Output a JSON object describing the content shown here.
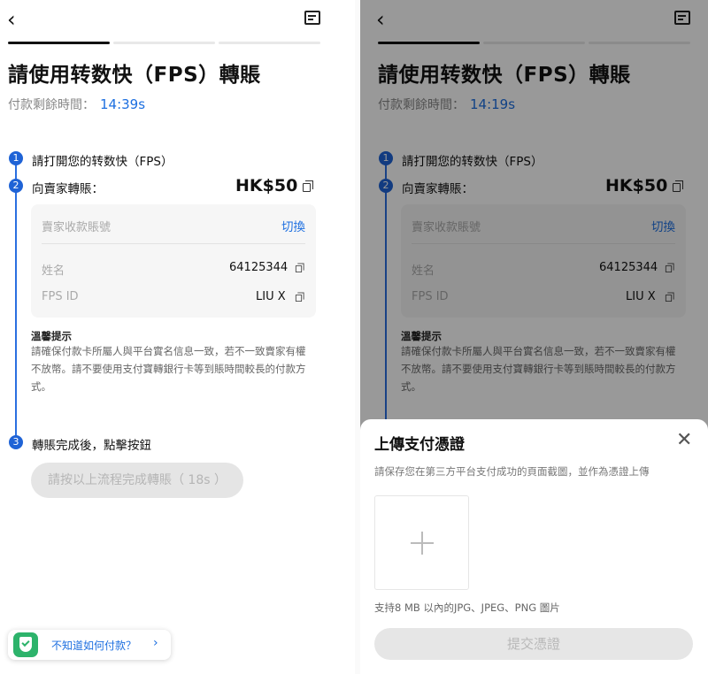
{
  "page": {
    "back_icon": "chevron-left-icon",
    "chat_icon": "message-icon",
    "title": "請使用转数快（FPS）轉賬",
    "timer_label": "付款剩餘時間：",
    "timer_left": "14:39s",
    "timer_right": "14:19s",
    "progress_steps": 3,
    "progress_active": 1
  },
  "steps": {
    "step1_num": "1",
    "step1_text": "請打開您的转数快（FPS）",
    "step2_num": "2",
    "step2_text": "向賣家轉賬：",
    "amount": "HK$50",
    "step3_num": "3",
    "step3_text": "轉賬完成後，點擊按鈕"
  },
  "card": {
    "account_label": "賣家收款賬號",
    "switch_label": "切換",
    "name_label": "姓名",
    "name_value": "64125344",
    "fpsid_label": "FPS ID",
    "fpsid_value": "LIU X"
  },
  "tip": {
    "title": "溫馨提示",
    "body": "請確保付款卡所屬人與平台實名信息一致，若不一致賣家有權不放幣。請不要使用支付寶轉銀行卡等到賬時間較長的付款方式。"
  },
  "confirm_button": "請按以上流程完成轉賬（ 18s ）",
  "help": {
    "text": "不知道如何付款？",
    "icon": "shield-check-icon",
    "arrow_icon": "chevron-right-icon"
  },
  "sheet": {
    "title": "上傳支付憑證",
    "close_icon": "close-icon",
    "description": "請保存您在第三方平台支付成功的頁面截圖，並作為憑證上傳",
    "upload_icon": "plus-icon",
    "note": "支持8 MB 以內的JPG、JPEG、PNG 圖片",
    "submit_label": "提交憑證"
  },
  "colors": {
    "accent": "#1d6fe0",
    "step_blue": "#1f63d6",
    "help_green": "#2db36b"
  }
}
